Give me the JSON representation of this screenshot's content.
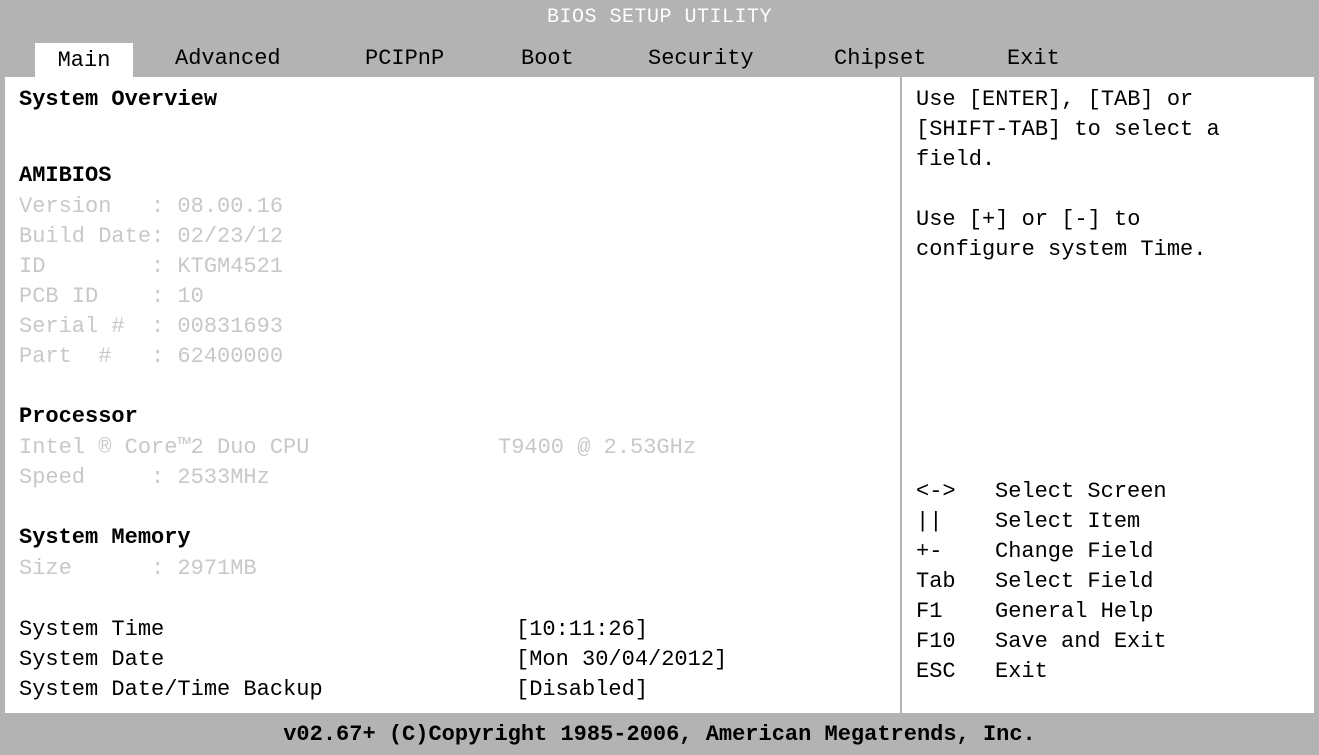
{
  "title": "BIOS SETUP UTILITY",
  "tabs": {
    "main": "Main",
    "advanced": "Advanced",
    "pcipnp": "PCIPnP",
    "boot": "Boot",
    "security": "Security",
    "chipset": "Chipset",
    "exit": "Exit"
  },
  "main": {
    "system_overview": "System Overview",
    "amibios": {
      "heading": "AMIBIOS",
      "version": "Version   : 08.00.16",
      "build_date": "Build Date: 02/23/12",
      "id": "ID        : KTGM4521",
      "pcb_id": "PCB ID    : 10",
      "serial": "Serial #  : 00831693",
      "part": "Part  #   : 62400000"
    },
    "processor": {
      "heading": "Processor",
      "cpu": "Intel ® Core™2 Duo CPU",
      "model": "T9400 @ 2.53GHz",
      "speed": "Speed     : 2533MHz"
    },
    "memory": {
      "heading": "System Memory",
      "size": "Size      : 2971MB"
    },
    "settings": {
      "time_label": "System Time",
      "time_value": "[10:11:26]",
      "date_label": "System Date",
      "date_value": "[Mon 30/04/2012]",
      "backup_label": "System Date/Time Backup",
      "backup_value": "[Disabled]"
    }
  },
  "help": {
    "line1": "Use [ENTER], [TAB] or",
    "line2": "[SHIFT-TAB] to select a",
    "line3": "field.",
    "line4": "Use [+] or [-] to",
    "line5": "configure system Time.",
    "keys": [
      {
        "key": "<->",
        "desc": "Select Screen"
      },
      {
        "key": "||",
        "desc": "Select Item"
      },
      {
        "key": "+-",
        "desc": "Change Field"
      },
      {
        "key": "Tab",
        "desc": "Select Field"
      },
      {
        "key": "F1",
        "desc": "General Help"
      },
      {
        "key": "F10",
        "desc": "Save and Exit"
      },
      {
        "key": "ESC",
        "desc": "Exit"
      }
    ]
  },
  "footer": "v02.67+ (C)Copyright 1985-2006, American Megatrends, Inc.",
  "colors": {
    "bar_gray": "#b3b3b3",
    "dim_text": "#c8c8c8",
    "background": "#ffffff"
  }
}
